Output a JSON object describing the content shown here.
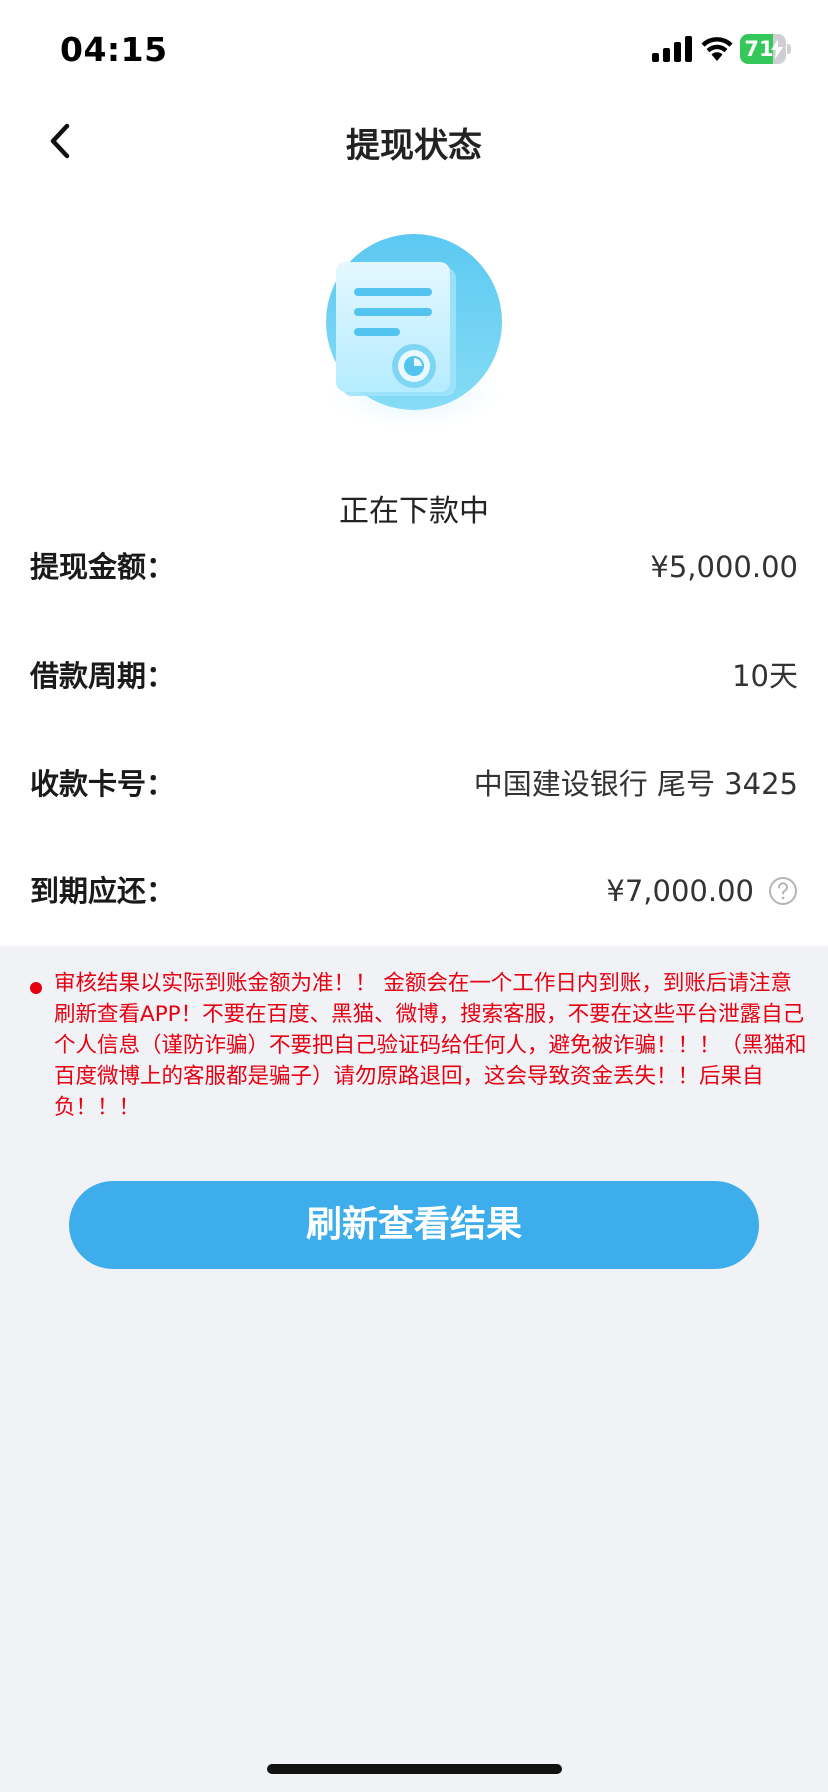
{
  "status_bar": {
    "time": "04:15",
    "battery_level": "71",
    "battery_fraction": 0.71,
    "signal_icon": "cellular-signal-icon",
    "wifi_icon": "wifi-icon",
    "battery_color": "#34c759"
  },
  "nav": {
    "title": "提现状态",
    "back_icon": "chevron-left-icon"
  },
  "status": {
    "icon": "document-clock-icon",
    "text": "正在下款中"
  },
  "details": {
    "withdraw_amount_label": "提现金额：",
    "withdraw_amount_value": "¥5,000.00",
    "loan_period_label": "借款周期：",
    "loan_period_value": "10天",
    "card_label": "收款卡号：",
    "card_value": "中国建设银行 尾号 3425",
    "due_label": "到期应还：",
    "due_value": "¥7,000.00",
    "help_icon": "question-circle-icon"
  },
  "notice": {
    "text": "审核结果以实际到账金额为准！！ 金额会在一个工作日内到账，到账后请注意刷新查看APP！不要在百度、黑猫、微博，搜索客服，不要在这些平台泄露自己个人信息（谨防诈骗）不要把自己验证码给任何人，避免被诈骗！！！（黑猫和百度微博上的客服都是骗子）请勿原路退回，这会导致资金丢失！！后果自负！！！",
    "color": "#e60012"
  },
  "actions": {
    "refresh_label": "刷新查看结果",
    "accent": "#3daeeb"
  }
}
